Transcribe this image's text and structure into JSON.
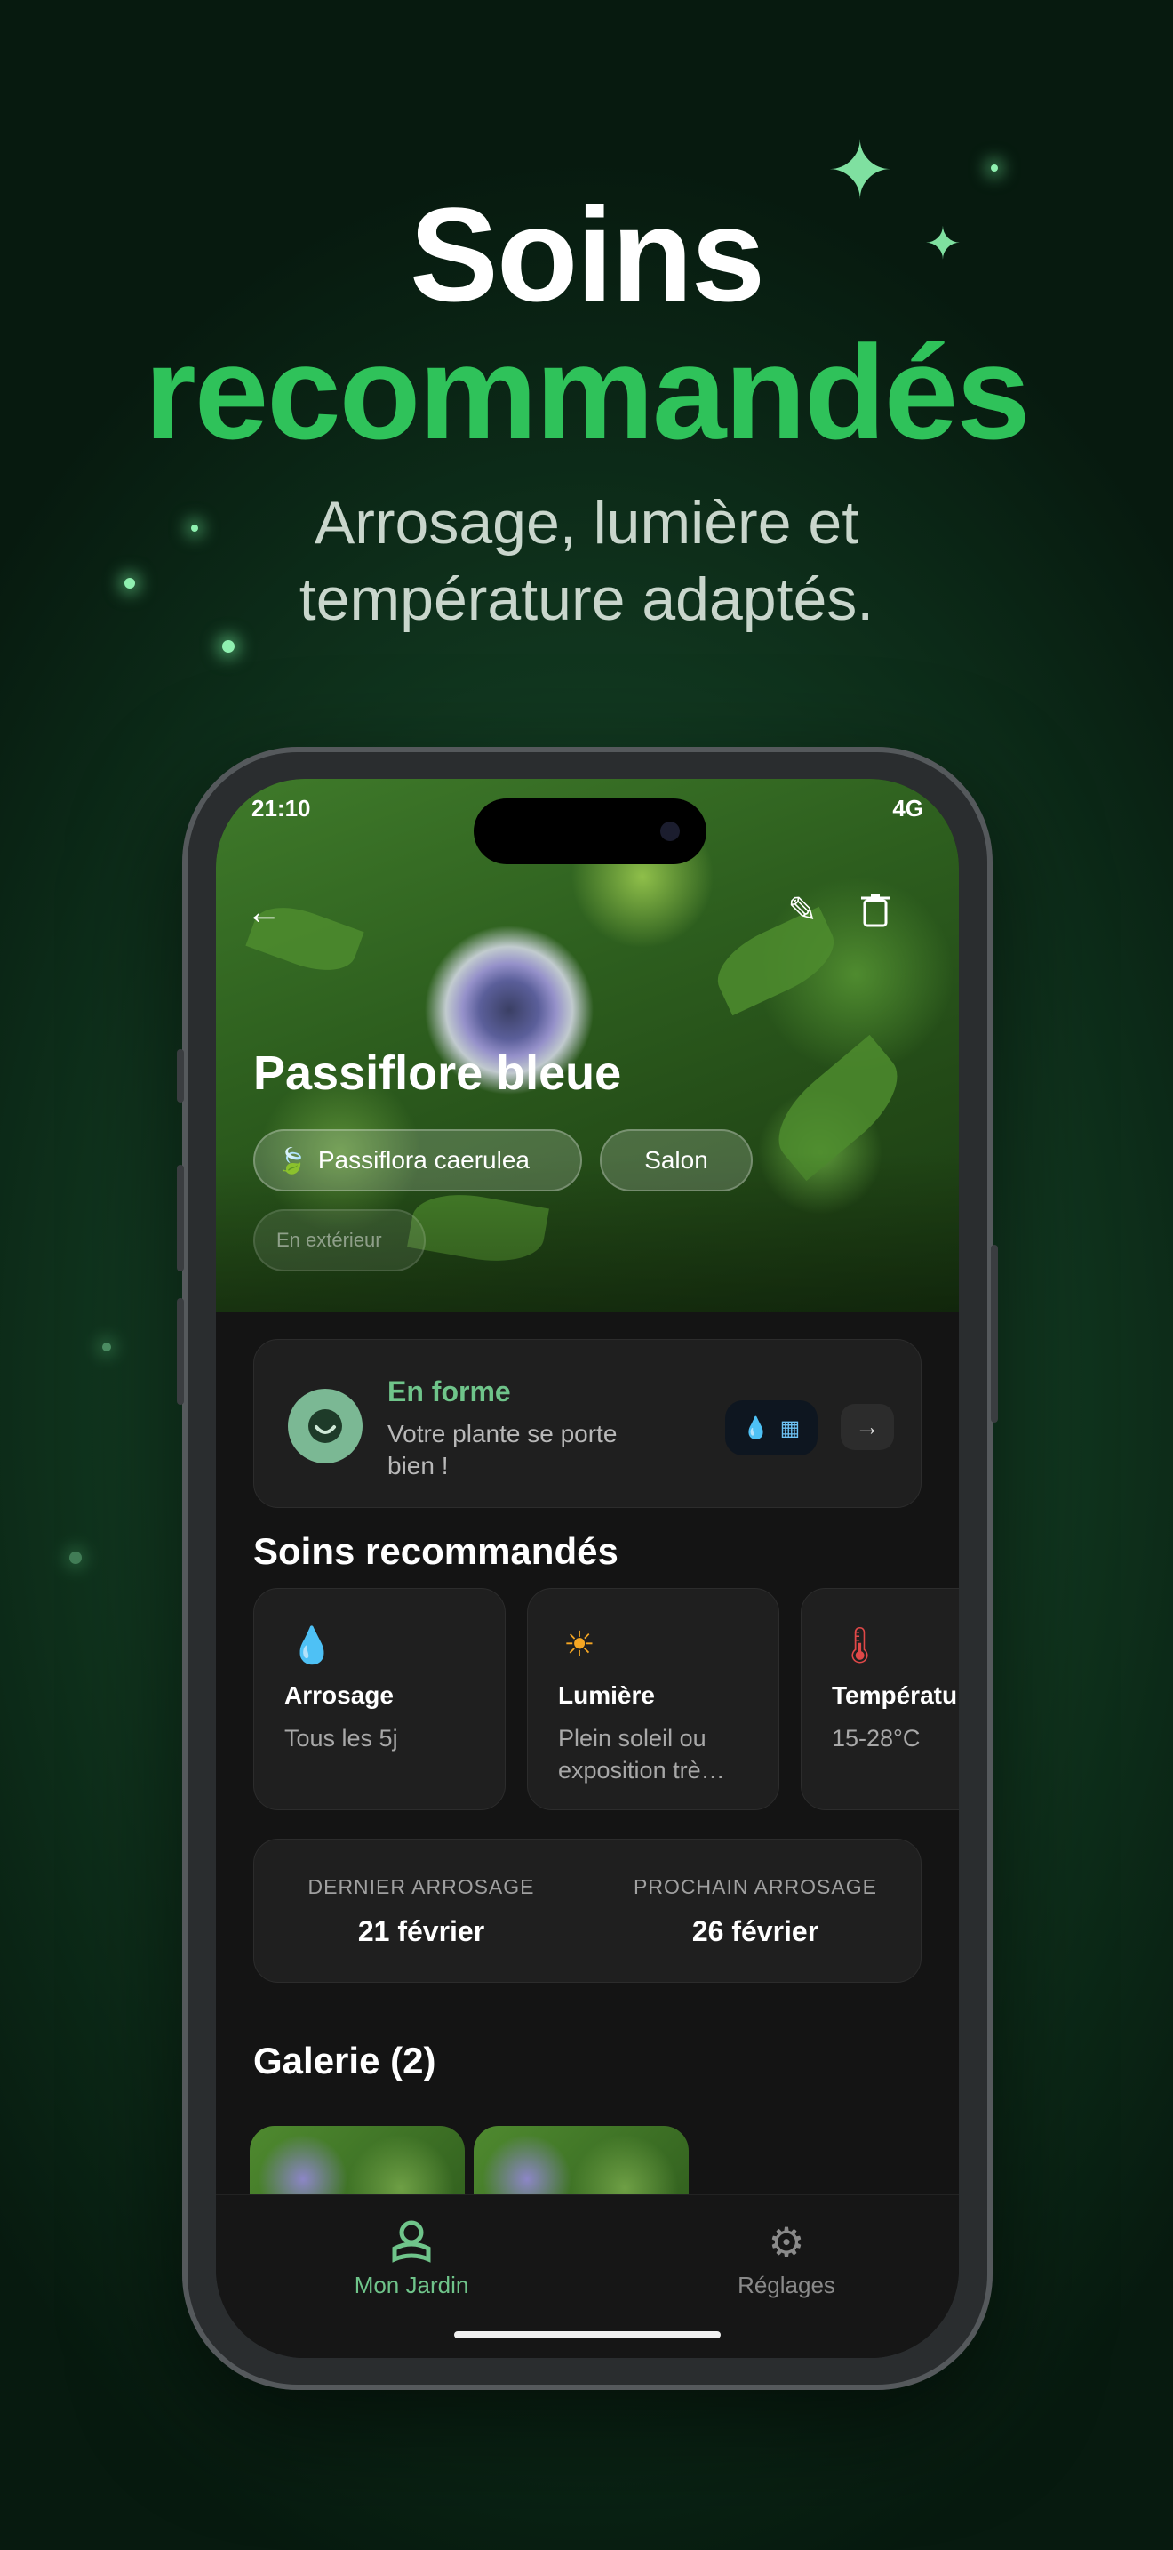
{
  "hero": {
    "title_line1": "Soins",
    "title_line2": "recommandés",
    "subtitle": "Arrosage, lumière et température adaptés."
  },
  "status_bar": {
    "time": "21:10",
    "battery": "4G"
  },
  "plant": {
    "name": "Passiflore bleue",
    "tags": [
      "Passiflora caerulea",
      "Salon"
    ],
    "extra_tag": "En extérieur"
  },
  "health": {
    "title": "En forme",
    "description": "Votre plante se porte bien !",
    "color": "#6fc48a"
  },
  "care": {
    "section_title": "Soins recommandés",
    "items": [
      {
        "icon": "water-drop-icon",
        "title": "Arrosage",
        "desc": "Tous les 5j"
      },
      {
        "icon": "sun-icon",
        "title": "Lumière",
        "desc": "Plein soleil ou exposition trè…"
      },
      {
        "icon": "thermometer-icon",
        "title": "Températu",
        "desc": "15-28°C"
      }
    ]
  },
  "watering": {
    "last_label": "DERNIER ARROSAGE",
    "last_value": "21 février",
    "next_label": "PROCHAIN ARROSAGE",
    "next_value": "26 février"
  },
  "gallery": {
    "title": "Galerie (2)"
  },
  "tabs": [
    {
      "label": "Mon Jardin",
      "icon": "plant-icon",
      "active": true
    },
    {
      "label": "Réglages",
      "icon": "gear-icon",
      "active": false
    }
  ],
  "colors": {
    "accent": "#2fc25a",
    "active_tab": "#6fc48a"
  }
}
